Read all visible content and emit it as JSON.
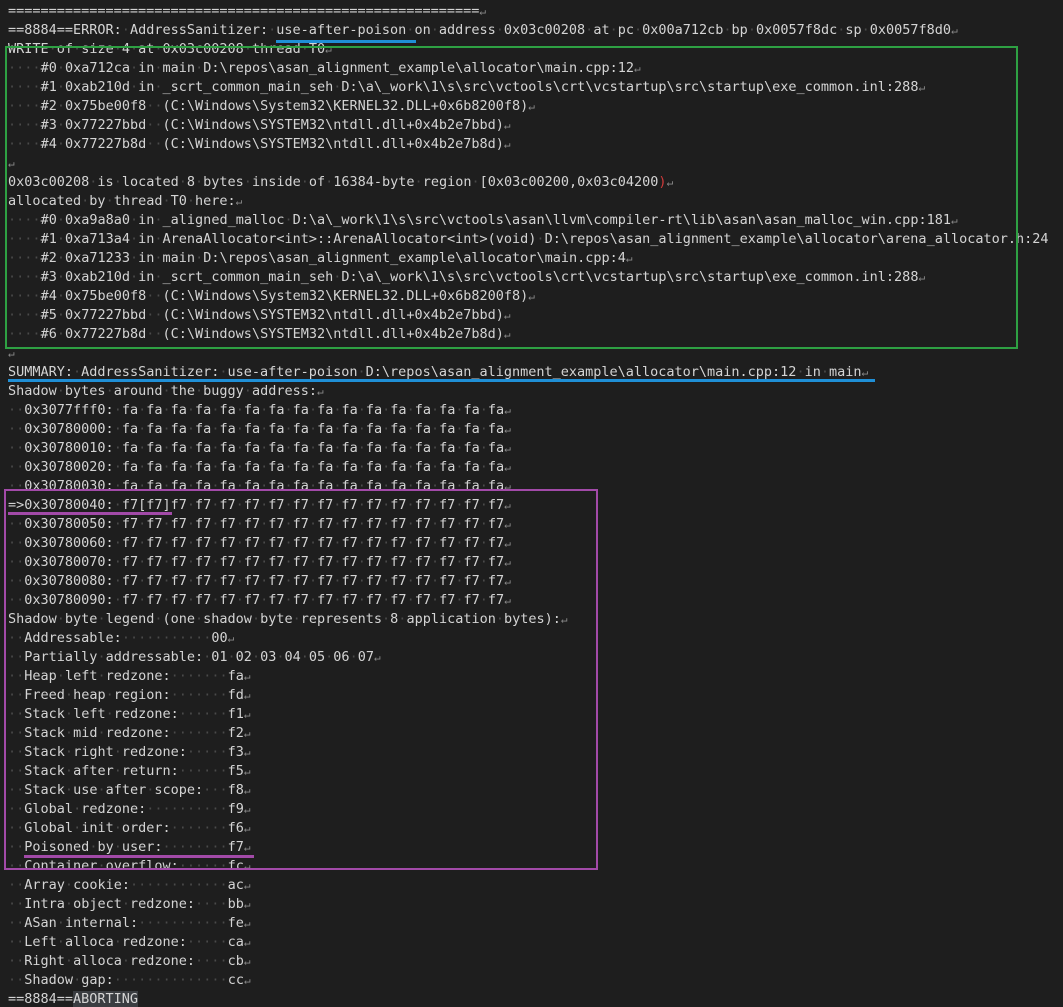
{
  "lines": [
    {
      "text": "=========================================================="
    },
    {
      "text": "==8884==ERROR: AddressSanitizer: use-after-poison on address 0x03c00208 at pc 0x00a712cb bp 0x0057f8dc sp 0x0057f8d0"
    },
    {
      "text": "WRITE of size 4 at 0x03c00208 thread T0"
    },
    {
      "text": "    #0 0xa712ca in main D:\\repos\\asan_alignment_example\\allocator\\main.cpp:12"
    },
    {
      "text": "    #1 0xab210d in _scrt_common_main_seh D:\\a\\_work\\1\\s\\src\\vctools\\crt\\vcstartup\\src\\startup\\exe_common.inl:288"
    },
    {
      "text": "    #2 0x75be00f8  (C:\\Windows\\System32\\KERNEL32.DLL+0x6b8200f8)"
    },
    {
      "text": "    #3 0x77227bbd  (C:\\Windows\\SYSTEM32\\ntdll.dll+0x4b2e7bbd)"
    },
    {
      "text": "    #4 0x77227b8d  (C:\\Windows\\SYSTEM32\\ntdll.dll+0x4b2e7b8d)"
    },
    {
      "text": ""
    },
    {
      "text": "0x03c00208 is located 8 bytes inside of 16384-byte region [0x03c00200,0x03c04200)"
    },
    {
      "text": "allocated by thread T0 here:"
    },
    {
      "text": "    #0 0xa9a8a0 in _aligned_malloc D:\\a\\_work\\1\\s\\src\\vctools\\asan\\llvm\\compiler-rt\\lib\\asan\\asan_malloc_win.cpp:181"
    },
    {
      "text": "    #1 0xa713a4 in ArenaAllocator<int>::ArenaAllocator<int>(void) D:\\repos\\asan_alignment_example\\allocator\\arena_allocator.h:24",
      "noeol": true
    },
    {
      "text": "    #2 0xa71233 in main D:\\repos\\asan_alignment_example\\allocator\\main.cpp:4"
    },
    {
      "text": "    #3 0xab210d in _scrt_common_main_seh D:\\a\\_work\\1\\s\\src\\vctools\\crt\\vcstartup\\src\\startup\\exe_common.inl:288"
    },
    {
      "text": "    #4 0x75be00f8  (C:\\Windows\\System32\\KERNEL32.DLL+0x6b8200f8)"
    },
    {
      "text": "    #5 0x77227bbd  (C:\\Windows\\SYSTEM32\\ntdll.dll+0x4b2e7bbd)"
    },
    {
      "text": "    #6 0x77227b8d  (C:\\Windows\\SYSTEM32\\ntdll.dll+0x4b2e7b8d)"
    },
    {
      "text": ""
    },
    {
      "text": "SUMMARY: AddressSanitizer: use-after-poison D:\\repos\\asan_alignment_example\\allocator\\main.cpp:12 in main"
    },
    {
      "text": "Shadow bytes around the buggy address:"
    },
    {
      "text": "  0x3077fff0: fa fa fa fa fa fa fa fa fa fa fa fa fa fa fa fa"
    },
    {
      "text": "  0x30780000: fa fa fa fa fa fa fa fa fa fa fa fa fa fa fa fa"
    },
    {
      "text": "  0x30780010: fa fa fa fa fa fa fa fa fa fa fa fa fa fa fa fa"
    },
    {
      "text": "  0x30780020: fa fa fa fa fa fa fa fa fa fa fa fa fa fa fa fa"
    },
    {
      "text": "  0x30780030: fa fa fa fa fa fa fa fa fa fa fa fa fa fa fa fa"
    },
    {
      "text": "=>0x30780040: f7[f7]f7 f7 f7 f7 f7 f7 f7 f7 f7 f7 f7 f7 f7 f7"
    },
    {
      "text": "  0x30780050: f7 f7 f7 f7 f7 f7 f7 f7 f7 f7 f7 f7 f7 f7 f7 f7"
    },
    {
      "text": "  0x30780060: f7 f7 f7 f7 f7 f7 f7 f7 f7 f7 f7 f7 f7 f7 f7 f7"
    },
    {
      "text": "  0x30780070: f7 f7 f7 f7 f7 f7 f7 f7 f7 f7 f7 f7 f7 f7 f7 f7"
    },
    {
      "text": "  0x30780080: f7 f7 f7 f7 f7 f7 f7 f7 f7 f7 f7 f7 f7 f7 f7 f7"
    },
    {
      "text": "  0x30780090: f7 f7 f7 f7 f7 f7 f7 f7 f7 f7 f7 f7 f7 f7 f7 f7"
    },
    {
      "text": "Shadow byte legend (one shadow byte represents 8 application bytes):"
    },
    {
      "text": "  Addressable:           00"
    },
    {
      "text": "  Partially addressable: 01 02 03 04 05 06 07"
    },
    {
      "text": "  Heap left redzone:       fa"
    },
    {
      "text": "  Freed heap region:       fd"
    },
    {
      "text": "  Stack left redzone:      f1"
    },
    {
      "text": "  Stack mid redzone:       f2"
    },
    {
      "text": "  Stack right redzone:     f3"
    },
    {
      "text": "  Stack after return:      f5"
    },
    {
      "text": "  Stack use after scope:   f8"
    },
    {
      "text": "  Global redzone:          f9"
    },
    {
      "text": "  Global init order:       f6"
    },
    {
      "text": "  Poisoned by user:        f7"
    },
    {
      "text": "  Container overflow:      fc"
    },
    {
      "text": "  Array cookie:            ac"
    },
    {
      "text": "  Intra object redzone:    bb"
    },
    {
      "text": "  ASan internal:           fe"
    },
    {
      "text": "  Left alloca redzone:     ca"
    },
    {
      "text": "  Right alloca redzone:    cb"
    },
    {
      "text": "  Shadow gap:              cc"
    },
    {
      "text": "==8884==ABORTING",
      "noeol": true
    }
  ],
  "colors": {
    "background": "#1e1e1e",
    "text": "#d4d4d4",
    "whitespace_dot": "#4a4a4a",
    "green_box": "#2ea043",
    "purple_box": "#a24aa8",
    "blue_underline": "#1f8fd6",
    "bracket_red": "#d13a3a"
  }
}
